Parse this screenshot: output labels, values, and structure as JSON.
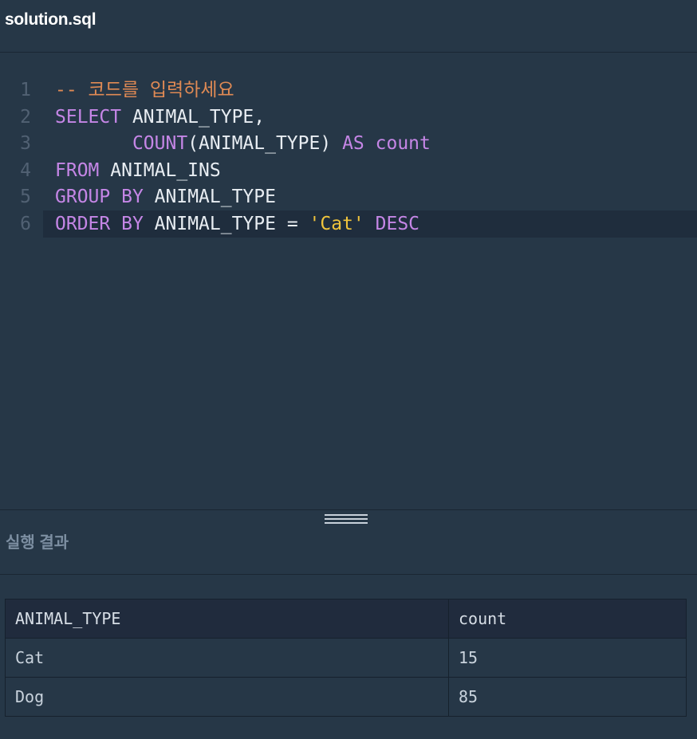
{
  "file": {
    "title": "solution.sql"
  },
  "editor": {
    "lines": [
      {
        "number": "1",
        "tokens": [
          {
            "text": "-- 코드를 입력하세요",
            "type": "comment"
          }
        ]
      },
      {
        "number": "2",
        "tokens": [
          {
            "text": "SELECT",
            "type": "kw"
          },
          {
            "text": " ANIMAL_TYPE,",
            "type": "plain"
          }
        ]
      },
      {
        "number": "3",
        "tokens": [
          {
            "text": "       ",
            "type": "plain"
          },
          {
            "text": "COUNT",
            "type": "kw"
          },
          {
            "text": "(ANIMAL_TYPE) ",
            "type": "plain"
          },
          {
            "text": "AS",
            "type": "kw"
          },
          {
            "text": " ",
            "type": "plain"
          },
          {
            "text": "count",
            "type": "kw"
          }
        ]
      },
      {
        "number": "4",
        "tokens": [
          {
            "text": "FROM",
            "type": "kw"
          },
          {
            "text": " ANIMAL_INS",
            "type": "plain"
          }
        ]
      },
      {
        "number": "5",
        "tokens": [
          {
            "text": "GROUP",
            "type": "kw"
          },
          {
            "text": " ",
            "type": "plain"
          },
          {
            "text": "BY",
            "type": "kw"
          },
          {
            "text": " ANIMAL_TYPE",
            "type": "plain"
          }
        ]
      },
      {
        "number": "6",
        "tokens": [
          {
            "text": "ORDER",
            "type": "kw"
          },
          {
            "text": " ",
            "type": "plain"
          },
          {
            "text": "BY",
            "type": "kw"
          },
          {
            "text": " ANIMAL_TYPE = ",
            "type": "plain"
          },
          {
            "text": "'Cat'",
            "type": "str"
          },
          {
            "text": " ",
            "type": "plain"
          },
          {
            "text": "DESC",
            "type": "kw"
          }
        ]
      }
    ],
    "active_line": 6
  },
  "result": {
    "title": "실행 결과",
    "columns": [
      "ANIMAL_TYPE",
      "count"
    ],
    "rows": [
      [
        "Cat",
        "15"
      ],
      [
        "Dog",
        "85"
      ]
    ]
  },
  "colors": {
    "background": "#263747",
    "keyword": "#c586e6",
    "comment": "#e08a54",
    "string": "#f0c43c",
    "plain": "#e8edf2",
    "line_number": "#516173"
  }
}
